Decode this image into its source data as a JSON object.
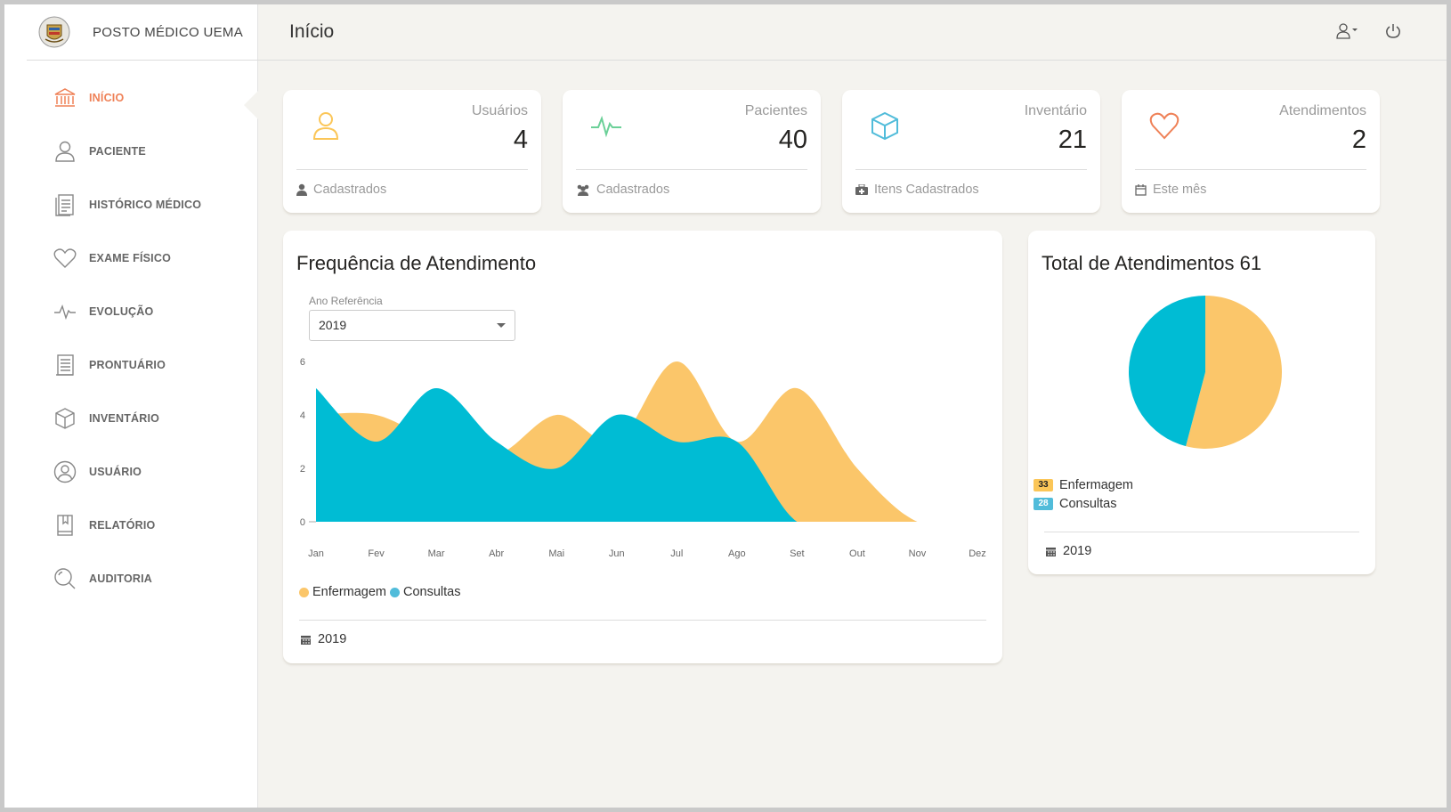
{
  "brand": {
    "name": "POSTO MÉDICO UEMA"
  },
  "page": {
    "title": "Início"
  },
  "sidebar": {
    "items": [
      {
        "label": "INÍCIO",
        "icon": "bank-icon",
        "active": true
      },
      {
        "label": "PACIENTE",
        "icon": "user-icon"
      },
      {
        "label": "HISTÓRICO MÉDICO",
        "icon": "document-icon"
      },
      {
        "label": "EXAME FÍSICO",
        "icon": "heart-icon"
      },
      {
        "label": "EVOLUÇÃO",
        "icon": "pulse-icon"
      },
      {
        "label": "PRONTUÁRIO",
        "icon": "notes-icon"
      },
      {
        "label": "INVENTÁRIO",
        "icon": "box-icon"
      },
      {
        "label": "USUÁRIO",
        "icon": "user-circle-icon"
      },
      {
        "label": "RELATÓRIO",
        "icon": "book-icon"
      },
      {
        "label": "AUDITORIA",
        "icon": "search-icon"
      }
    ]
  },
  "stats": [
    {
      "label": "Usuários",
      "value": "4",
      "footer": "Cadastrados",
      "icon": "user-icon",
      "color": "#fbc658"
    },
    {
      "label": "Pacientes",
      "value": "40",
      "footer": "Cadastrados",
      "icon": "pulse-icon",
      "color": "#6bd098"
    },
    {
      "label": "Inventário",
      "value": "21",
      "footer": "Itens Cadastrados",
      "icon": "box-icon",
      "color": "#51bcda"
    },
    {
      "label": "Atendimentos",
      "value": "2",
      "footer": "Este mês",
      "icon": "heart-icon",
      "color": "#ef8157"
    }
  ],
  "frequency": {
    "title": "Frequência de Atendimento",
    "select_label": "Ano Referência",
    "select_value": "2019",
    "footer": "2019"
  },
  "total": {
    "title": "Total de Atendimentos 61",
    "footer": "2019"
  },
  "colors": {
    "enfermagem": "#fbc66a",
    "consultas": "#00bcd4",
    "accent": "#ef8157"
  },
  "chart_data": [
    {
      "type": "area",
      "categories": [
        "Jan",
        "Fev",
        "Mar",
        "Abr",
        "Mai",
        "Jun",
        "Jul",
        "Ago",
        "Set",
        "Out",
        "Nov",
        "Dez"
      ],
      "series": [
        {
          "name": "Enfermagem",
          "values": [
            4,
            4,
            3,
            2.5,
            4,
            3,
            6,
            3,
            5,
            2,
            0,
            0
          ]
        },
        {
          "name": "Consultas",
          "values": [
            5,
            3,
            5,
            3,
            2,
            4,
            3,
            3,
            0,
            0,
            0,
            0
          ]
        }
      ],
      "ylim": [
        0,
        6
      ],
      "yticks": [
        "0",
        "2",
        "4",
        "6"
      ],
      "legend_position": "bottom-left"
    },
    {
      "type": "pie",
      "categories": [
        "Enfermagem",
        "Consultas"
      ],
      "values": [
        33,
        28
      ],
      "labels": [
        "33",
        "28"
      ]
    }
  ]
}
